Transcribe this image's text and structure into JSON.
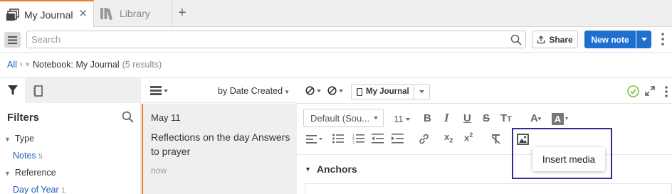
{
  "tabs": [
    {
      "label": "My Journal",
      "active": true
    },
    {
      "label": "Library",
      "active": false
    }
  ],
  "colors": {
    "accent": "#f07c24",
    "primary": "#1f6fd0",
    "link": "#1f5fb5",
    "highlight_box": "#2b2f8f",
    "saved_check": "#7cc043"
  },
  "toolbar": {
    "search_placeholder": "Search",
    "share_label": "Share",
    "new_note_label": "New note"
  },
  "breadcrumb": {
    "root": "All",
    "filter": "Notebook: My Journal",
    "count": "(5 results)"
  },
  "filters": {
    "title": "Filters",
    "items": [
      {
        "label": "Type"
      },
      {
        "label": "Notes",
        "count": "5"
      },
      {
        "label": "Reference"
      },
      {
        "label": "Day of Year",
        "count": "1"
      }
    ]
  },
  "list": {
    "sort_label": "by Date Created",
    "note": {
      "date": "May 11",
      "title": "Reflections on the day Answers to prayer",
      "time": "now"
    }
  },
  "editor": {
    "notebook": "My Journal",
    "font": "Default (Sou...",
    "size": "11",
    "tooltip": "Insert media",
    "section": "Anchors",
    "icons": [
      "no-status-icon",
      "notebook-icon",
      "saved-check-icon",
      "expand-icon",
      "bold-icon",
      "italic-icon",
      "underline-icon",
      "strikethrough-icon",
      "text-size-icon",
      "font-color-icon",
      "highlight-color-icon",
      "align-icon",
      "bulleted-list-icon",
      "numbered-list-icon",
      "outdent-icon",
      "indent-icon",
      "link-icon",
      "subscript-icon",
      "superscript-icon",
      "clear-format-icon",
      "image-icon"
    ]
  }
}
